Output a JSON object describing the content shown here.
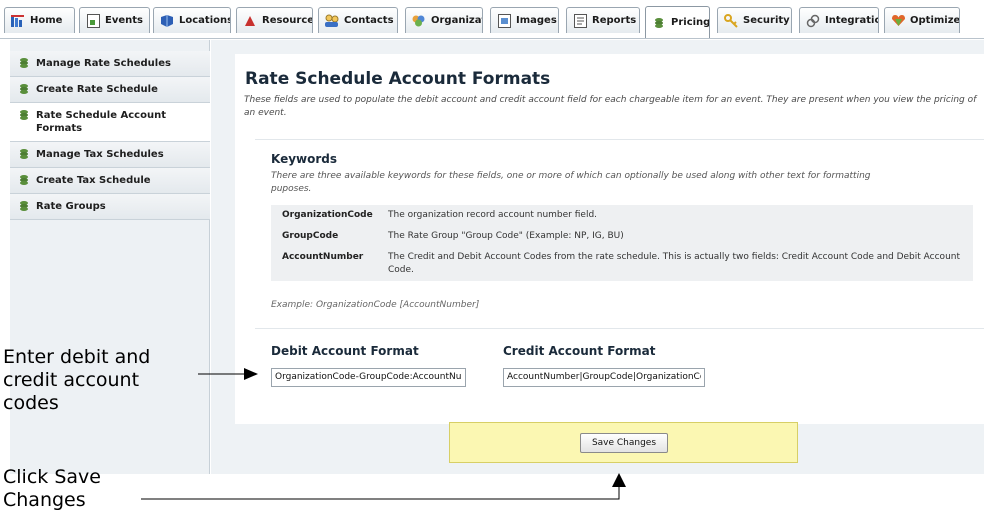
{
  "tabs": [
    {
      "label": "Home",
      "icon": "home-icon"
    },
    {
      "label": "Events",
      "icon": "events-icon"
    },
    {
      "label": "Locations",
      "icon": "locations-icon"
    },
    {
      "label": "Resource",
      "icon": "resources-icon"
    },
    {
      "label": "Contacts",
      "icon": "contacts-icon"
    },
    {
      "label": "Organizat",
      "icon": "organizations-icon"
    },
    {
      "label": "Images",
      "icon": "images-icon"
    },
    {
      "label": "Reports",
      "icon": "reports-icon"
    },
    {
      "label": "Pricing",
      "icon": "pricing-icon",
      "active": true
    },
    {
      "label": "Security",
      "icon": "security-icon"
    },
    {
      "label": "Integratic",
      "icon": "integration-icon"
    },
    {
      "label": "Optimizer",
      "icon": "optimizer-icon"
    }
  ],
  "sidebar": {
    "items": [
      {
        "label": "Manage Rate Schedules"
      },
      {
        "label": "Create Rate Schedule"
      },
      {
        "label": "Rate Schedule Account Formats",
        "active": true
      },
      {
        "label": "Manage Tax Schedules"
      },
      {
        "label": "Create Tax Schedule"
      },
      {
        "label": "Rate Groups"
      }
    ]
  },
  "main": {
    "title": "Rate Schedule Account Formats",
    "description": "These fields are used to populate the debit account and credit account field for each chargeable item for an event. They are present when you view the pricing of an event.",
    "keywords": {
      "title": "Keywords",
      "description": "There are three available keywords for these fields, one or more of which can optionally be used along with other text for formatting puposes.",
      "rows": [
        {
          "name": "OrganizationCode",
          "text": "The organization record account number field."
        },
        {
          "name": "GroupCode",
          "text": "The Rate Group \"Group Code\" (Example: NP, IG, BU)"
        },
        {
          "name": "AccountNumber",
          "text": "The Credit and Debit Account Codes from the rate schedule. This is actually two fields: Credit Account Code and Debit Account Code."
        }
      ],
      "example": "Example: OrganizationCode [AccountNumber]"
    },
    "debit": {
      "label": "Debit Account Format",
      "value": "OrganizationCode-GroupCode:AccountNumber"
    },
    "credit": {
      "label": "Credit Account Format",
      "value": "AccountNumber|GroupCode|OrganizationCode"
    },
    "save_label": "Save Changes"
  },
  "annotations": {
    "enter_codes": "Enter debit and credit account codes",
    "click_save": "Click Save Changes"
  },
  "colors": {
    "pricing_icon": "#5a8f3c",
    "save_area": "#fbf7b2"
  }
}
